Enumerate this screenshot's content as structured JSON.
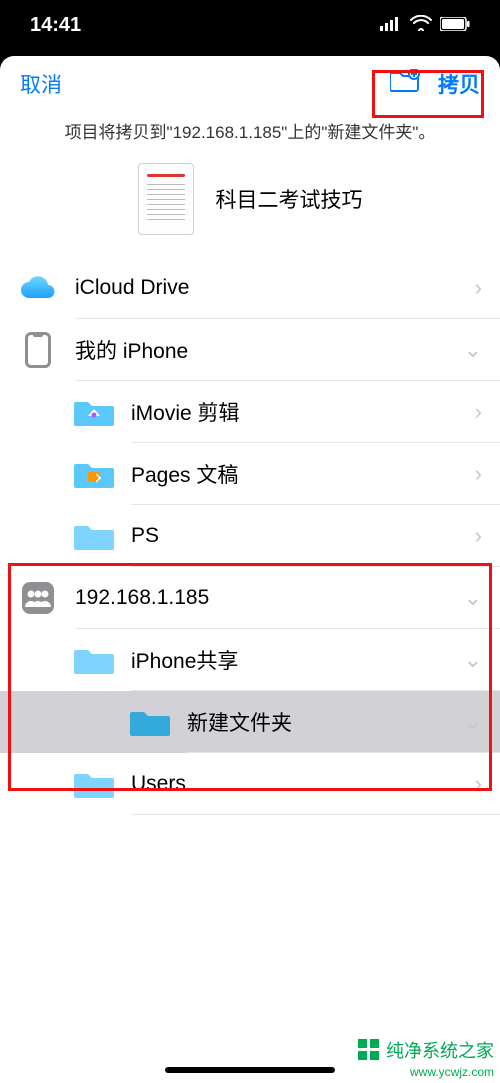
{
  "status": {
    "time": "14:41"
  },
  "nav": {
    "cancel": "取消",
    "copy": "拷贝"
  },
  "subtitle": "项目将拷贝到\"192.168.1.185\"上的\"新建文件夹\"。",
  "doc": {
    "title": "科目二考试技巧"
  },
  "rows": {
    "icloud": "iCloud Drive",
    "iphone": "我的 iPhone",
    "imovie": "iMovie 剪辑",
    "pages": "Pages 文稿",
    "ps": "PS",
    "server": "192.168.1.185",
    "share": "iPhone共享",
    "newfolder": "新建文件夹",
    "users": "Users"
  },
  "watermark": {
    "text": "纯净系统之家",
    "url": "www.ycwjz.com"
  }
}
